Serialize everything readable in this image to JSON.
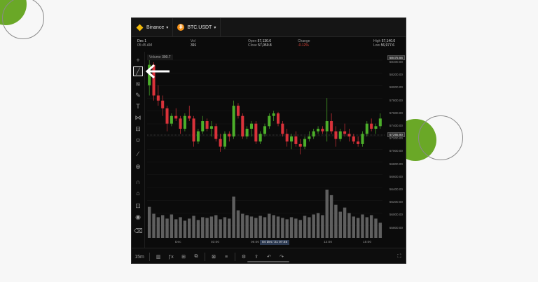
{
  "topbar": {
    "exchange_label": "Binance",
    "pair_label": "BTC.USDT"
  },
  "info": {
    "date": "Dec 1",
    "time": "05:45 AM",
    "vol_label": "Vol",
    "vol_value": "391",
    "open_label": "Open",
    "open_value": "57,130.6",
    "close_label": "Close",
    "close_value": "57,059.8",
    "change_label": "Change",
    "change_value": "-0.12%",
    "high_label": "High",
    "high_value": "57,140.0",
    "low_label": "Low",
    "low_value": "56,977.6"
  },
  "volume_overlay": {
    "label": "Volume",
    "value": "390.7"
  },
  "price_axis": {
    "ticks": [
      "58400.00",
      "58200.00",
      "58000.00",
      "57800.00",
      "57600.00",
      "57400.00",
      "57200.00",
      "57000.00",
      "56800.00",
      "56600.00",
      "56400.00",
      "56200.00",
      "56000.00",
      "55800.00"
    ],
    "top_label": "58475.56",
    "current_label": "57265.90"
  },
  "time_axis": {
    "ticks": [
      "Dec",
      "03:00",
      "06:00",
      "12:00",
      "15:00"
    ],
    "highlight": "04 Dec '21   07:45"
  },
  "bottombar": {
    "interval": "15m"
  },
  "colors": {
    "up": "#4caf2a",
    "down": "#d9323a",
    "accent": "#f0b90b"
  },
  "chart_data": {
    "type": "candlestick",
    "ylim": [
      55750,
      58500
    ],
    "candles": [
      [
        57900,
        58480,
        57700,
        58300
      ],
      [
        58300,
        58350,
        57600,
        57700
      ],
      [
        57700,
        57900,
        57500,
        57600
      ],
      [
        57600,
        57700,
        57300,
        57450
      ],
      [
        57450,
        57500,
        57000,
        57150
      ],
      [
        57150,
        57350,
        57100,
        57300
      ],
      [
        57300,
        57450,
        57200,
        57250
      ],
      [
        57250,
        57300,
        56950,
        57050
      ],
      [
        57050,
        57350,
        57000,
        57300
      ],
      [
        57300,
        57500,
        57200,
        57250
      ],
      [
        57250,
        57300,
        56700,
        56800
      ],
      [
        56800,
        57050,
        56750,
        57000
      ],
      [
        57000,
        57300,
        56950,
        57200
      ],
      [
        57200,
        57250,
        57000,
        57050
      ],
      [
        57050,
        57200,
        56900,
        57100
      ],
      [
        57100,
        57150,
        56800,
        56850
      ],
      [
        56850,
        56950,
        56600,
        56700
      ],
      [
        56700,
        57000,
        56650,
        56950
      ],
      [
        56950,
        57000,
        56800,
        56900
      ],
      [
        56900,
        57600,
        56850,
        57500
      ],
      [
        57500,
        57550,
        57250,
        57300
      ],
      [
        57300,
        57350,
        56850,
        56900
      ],
      [
        56900,
        57100,
        56850,
        57050
      ],
      [
        57050,
        57200,
        56900,
        57150
      ],
      [
        57150,
        57200,
        56750,
        56800
      ],
      [
        56800,
        57000,
        56750,
        56950
      ],
      [
        56950,
        57150,
        56900,
        57100
      ],
      [
        57100,
        57350,
        57050,
        57300
      ],
      [
        57300,
        57400,
        57200,
        57350
      ],
      [
        57350,
        57380,
        57100,
        57150
      ],
      [
        57150,
        57200,
        56900,
        56950
      ],
      [
        56950,
        57050,
        56700,
        56800
      ],
      [
        56800,
        56950,
        56650,
        56900
      ],
      [
        56900,
        57000,
        56700,
        56750
      ],
      [
        56750,
        56850,
        56550,
        56700
      ],
      [
        56700,
        56900,
        56650,
        56850
      ],
      [
        56850,
        57000,
        56800,
        56900
      ],
      [
        56900,
        57050,
        56850,
        57000
      ],
      [
        57000,
        57100,
        56950,
        57050
      ],
      [
        57050,
        57100,
        56950,
        57000
      ],
      [
        57000,
        57650,
        56800,
        57200
      ],
      [
        57200,
        57350,
        56950,
        57000
      ],
      [
        57000,
        57100,
        56700,
        56850
      ],
      [
        56850,
        57050,
        56800,
        57000
      ],
      [
        57000,
        57150,
        56900,
        56950
      ],
      [
        56950,
        57050,
        56800,
        56900
      ],
      [
        56900,
        56950,
        56750,
        56800
      ],
      [
        56800,
        56900,
        56700,
        56750
      ],
      [
        56750,
        57000,
        56700,
        56950
      ],
      [
        56950,
        57200,
        56900,
        57150
      ],
      [
        57150,
        57250,
        57000,
        57050
      ],
      [
        57050,
        57150,
        56950,
        57100
      ],
      [
        57100,
        57350,
        57050,
        57250
      ]
    ],
    "volumes": [
      45,
      35,
      30,
      33,
      28,
      34,
      27,
      30,
      25,
      28,
      32,
      26,
      30,
      29,
      31,
      33,
      27,
      30,
      28,
      60,
      40,
      35,
      33,
      31,
      29,
      32,
      30,
      35,
      33,
      31,
      29,
      27,
      30,
      28,
      26,
      32,
      30,
      34,
      36,
      33,
      70,
      62,
      48,
      38,
      44,
      36,
      31,
      29,
      34,
      30,
      33,
      28,
      22
    ]
  }
}
